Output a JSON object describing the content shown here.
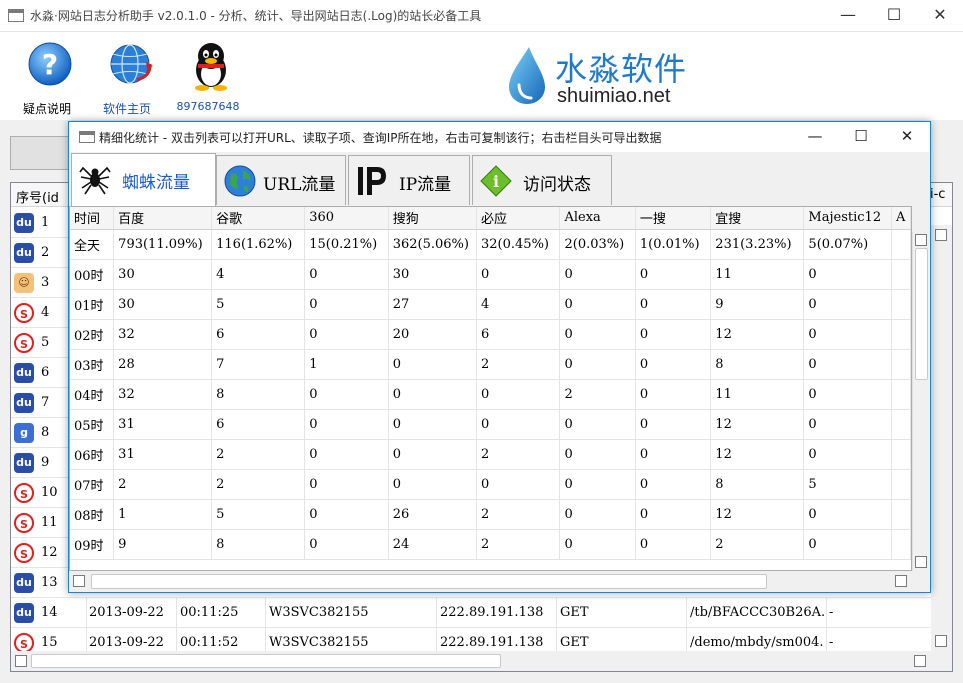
{
  "window": {
    "title": "水淼·网站日志分析助手 v2.0.1.0 - 分析、统计、导出网站日志(.Log)的站长必备工具",
    "minimize": "—",
    "maximize": "☐",
    "close": "✕"
  },
  "toolbar": {
    "help_label": "疑点说明",
    "home_label": "软件主页",
    "qq_label": "897687648"
  },
  "logo": {
    "cn": "水淼软件",
    "en": "shuimiao.net"
  },
  "main_list": {
    "col_seq": "序号(id",
    "col_right": "i-c",
    "rows": [
      {
        "num": "1",
        "icon": "baidu"
      },
      {
        "num": "2",
        "icon": "baidu"
      },
      {
        "num": "3",
        "icon": "user"
      },
      {
        "num": "4",
        "icon": "so"
      },
      {
        "num": "5",
        "icon": "so"
      },
      {
        "num": "6",
        "icon": "baidu"
      },
      {
        "num": "7",
        "icon": "baidu"
      },
      {
        "num": "8",
        "icon": "google"
      },
      {
        "num": "9",
        "icon": "baidu"
      },
      {
        "num": "10",
        "icon": "so"
      },
      {
        "num": "11",
        "icon": "so"
      },
      {
        "num": "12",
        "icon": "so"
      },
      {
        "num": "13",
        "icon": "baidu"
      }
    ],
    "full_rows": [
      {
        "num": "14",
        "icon": "baidu",
        "date": "2013-09-22",
        "time": "00:11:25",
        "site": "W3SVC382155",
        "ip": "222.89.191.138",
        "method": "GET",
        "url": "/tb/BFACCC30B26A.",
        "status": "-"
      },
      {
        "num": "15",
        "icon": "so",
        "date": "2013-09-22",
        "time": "00:11:52",
        "site": "W3SVC382155",
        "ip": "222.89.191.138",
        "method": "GET",
        "url": "/demo/mbdy/sm004.",
        "status": "-"
      }
    ]
  },
  "sub_window": {
    "title": "精细化统计 - 双击列表可以打开URL、读取子项、查询IP所在地，右击可复制该行；右击栏目头可导出数据",
    "minimize": "—",
    "maximize": "☐",
    "close": "✕",
    "tabs": [
      {
        "label": "蜘蛛流量",
        "icon": "spider-icon"
      },
      {
        "label": "URL流量",
        "icon": "globe-icon"
      },
      {
        "label": "IP流量",
        "icon": "ip-icon"
      },
      {
        "label": "访问状态",
        "icon": "info-diamond-icon"
      }
    ]
  },
  "grid": {
    "headers": [
      "时间",
      "百度",
      "谷歌",
      "360",
      "搜狗",
      "必应",
      "Alexa",
      "一搜",
      "宜搜",
      "Majestic12",
      "A"
    ],
    "rows": [
      [
        "全天",
        "793(11.09%)",
        "116(1.62%)",
        "15(0.21%)",
        "362(5.06%)",
        "32(0.45%)",
        "2(0.03%)",
        "1(0.01%)",
        "231(3.23%)",
        "5(0.07%)"
      ],
      [
        "00时",
        "30",
        "4",
        "0",
        "30",
        "0",
        "0",
        "0",
        "11",
        "0"
      ],
      [
        "01时",
        "30",
        "5",
        "0",
        "27",
        "4",
        "0",
        "0",
        "9",
        "0"
      ],
      [
        "02时",
        "32",
        "6",
        "0",
        "20",
        "6",
        "0",
        "0",
        "12",
        "0"
      ],
      [
        "03时",
        "28",
        "7",
        "1",
        "0",
        "2",
        "0",
        "0",
        "8",
        "0"
      ],
      [
        "04时",
        "32",
        "8",
        "0",
        "0",
        "0",
        "2",
        "0",
        "11",
        "0"
      ],
      [
        "05时",
        "31",
        "6",
        "0",
        "0",
        "0",
        "0",
        "0",
        "12",
        "0"
      ],
      [
        "06时",
        "31",
        "2",
        "0",
        "0",
        "2",
        "0",
        "0",
        "12",
        "0"
      ],
      [
        "07时",
        "2",
        "2",
        "0",
        "0",
        "0",
        "0",
        "0",
        "8",
        "5"
      ],
      [
        "08时",
        "1",
        "5",
        "0",
        "26",
        "2",
        "0",
        "0",
        "12",
        "0"
      ],
      [
        "09时",
        "9",
        "8",
        "0",
        "24",
        "2",
        "0",
        "0",
        "2",
        "0"
      ]
    ]
  },
  "colors": {
    "accent": "#1883d7",
    "tab_active_text": "#1a5cc8",
    "logo_blue": "#1f7ac9"
  }
}
